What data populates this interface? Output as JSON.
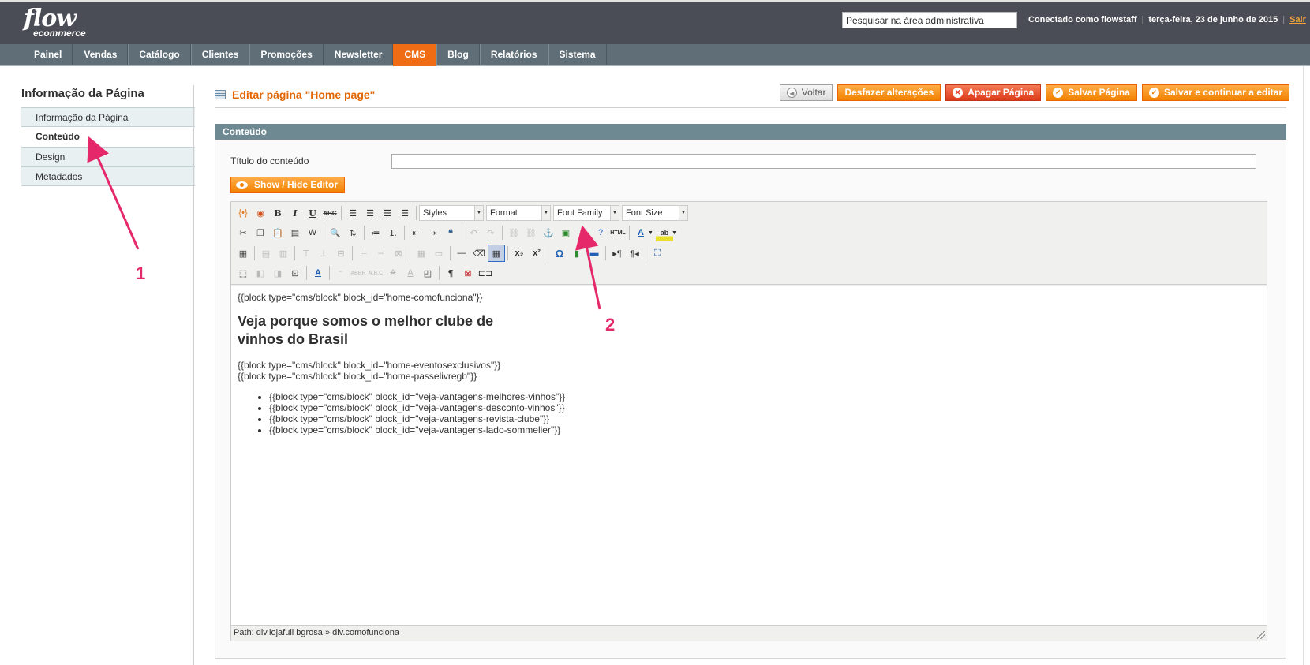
{
  "header": {
    "logo_line1": "flow",
    "logo_line2": "ecommerce",
    "search_placeholder": "Pesquisar na área administrativa",
    "logged_in": "Conectado como flowstaff",
    "date": "terça-feira, 23 de junho de 2015",
    "logout": "Sair"
  },
  "nav": {
    "items": [
      {
        "label": "Painel"
      },
      {
        "label": "Vendas"
      },
      {
        "label": "Catálogo"
      },
      {
        "label": "Clientes"
      },
      {
        "label": "Promoções"
      },
      {
        "label": "Newsletter"
      },
      {
        "label": "CMS",
        "active": true
      },
      {
        "label": "Blog"
      },
      {
        "label": "Relatórios"
      },
      {
        "label": "Sistema"
      }
    ]
  },
  "sidebar": {
    "title": "Informação da Página",
    "items": [
      {
        "label": "Informação da Página"
      },
      {
        "label": "Conteúdo",
        "active": true
      },
      {
        "label": "Design"
      },
      {
        "label": "Metadados"
      }
    ]
  },
  "page": {
    "title": "Editar página \"Home page\"",
    "actions": {
      "back": "Voltar",
      "reset": "Desfazer alterações",
      "delete": "Apagar Página",
      "save": "Salvar Página",
      "save_continue": "Salvar e continuar a editar"
    }
  },
  "section": {
    "title": "Conteúdo",
    "content_title_label": "Título do conteúdo",
    "content_title_value": "",
    "show_hide": "Show / Hide Editor"
  },
  "editor": {
    "selects": {
      "styles": "Styles",
      "format": "Format",
      "font_family": "Font Family",
      "font_size": "Font Size"
    },
    "content": {
      "line1": "{{block type=\"cms/block\" block_id=\"home-comofunciona\"}}",
      "heading": "Veja porque somos o melhor clube de vinhos do Brasil",
      "line2": "{{block type=\"cms/block\" block_id=\"home-eventosexclusivos\"}}",
      "line3": "{{block type=\"cms/block\" block_id=\"home-passelivregb\"}}",
      "list": [
        "{{block type=\"cms/block\" block_id=\"veja-vantagens-melhores-vinhos\"}}",
        "{{block type=\"cms/block\" block_id=\"veja-vantagens-desconto-vinhos\"}}",
        "{{block type=\"cms/block\" block_id=\"veja-vantagens-revista-clube\"}}",
        "{{block type=\"cms/block\" block_id=\"veja-vantagens-lado-sommelier\"}}"
      ]
    },
    "path": "Path: div.lojafull bgrosa » div.comofunciona"
  },
  "annotations": {
    "n1": "1",
    "n2": "2",
    "color": "#e5286a"
  },
  "colors": {
    "accent": "#f06c14",
    "header": "#4a4d55",
    "nav": "#5f6e77",
    "section_head": "#6f8992"
  }
}
